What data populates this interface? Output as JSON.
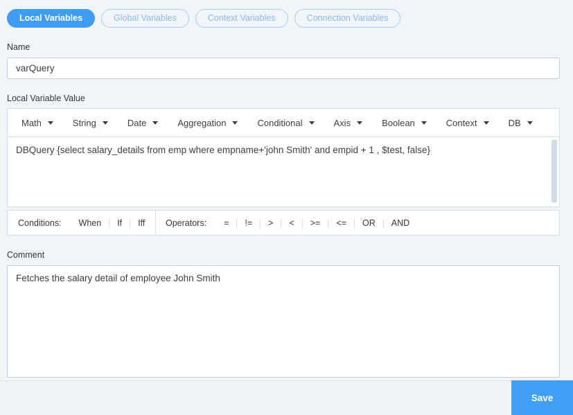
{
  "tabs": [
    {
      "label": "Local Variables",
      "active": true
    },
    {
      "label": "Global Variables",
      "active": false
    },
    {
      "label": "Context Variables",
      "active": false
    },
    {
      "label": "Connection Variables",
      "active": false
    }
  ],
  "name_field": {
    "label": "Name",
    "value": "varQuery"
  },
  "value_editor": {
    "label": "Local Variable Value",
    "toolbar": [
      "Math",
      "String",
      "Date",
      "Aggregation",
      "Conditional",
      "Axis",
      "Boolean",
      "Context",
      "DB"
    ],
    "value": "DBQuery {select salary_details from emp where empname+'john Smith' and empid + 1 , $test, false}",
    "conditions": {
      "label": "Conditions:",
      "items": [
        "When",
        "If",
        "Iff"
      ]
    },
    "operators": {
      "label": "Operators:",
      "items": [
        "=",
        "!=",
        ">",
        "<",
        ">=",
        "<=",
        "OR",
        "AND"
      ]
    }
  },
  "comment_field": {
    "label": "Comment",
    "value": "Fetches the salary detail of employee John Smith"
  },
  "footer": {
    "save_label": "Save"
  },
  "colors": {
    "accent_blue": "#3f9cf3",
    "save_blue": "#41a0f5",
    "inactive_tab_border": "#a9cdf5",
    "inactive_tab_text": "#8db8ee",
    "page_background": "#f1f5f9",
    "panel_border": "#d9dee3"
  }
}
